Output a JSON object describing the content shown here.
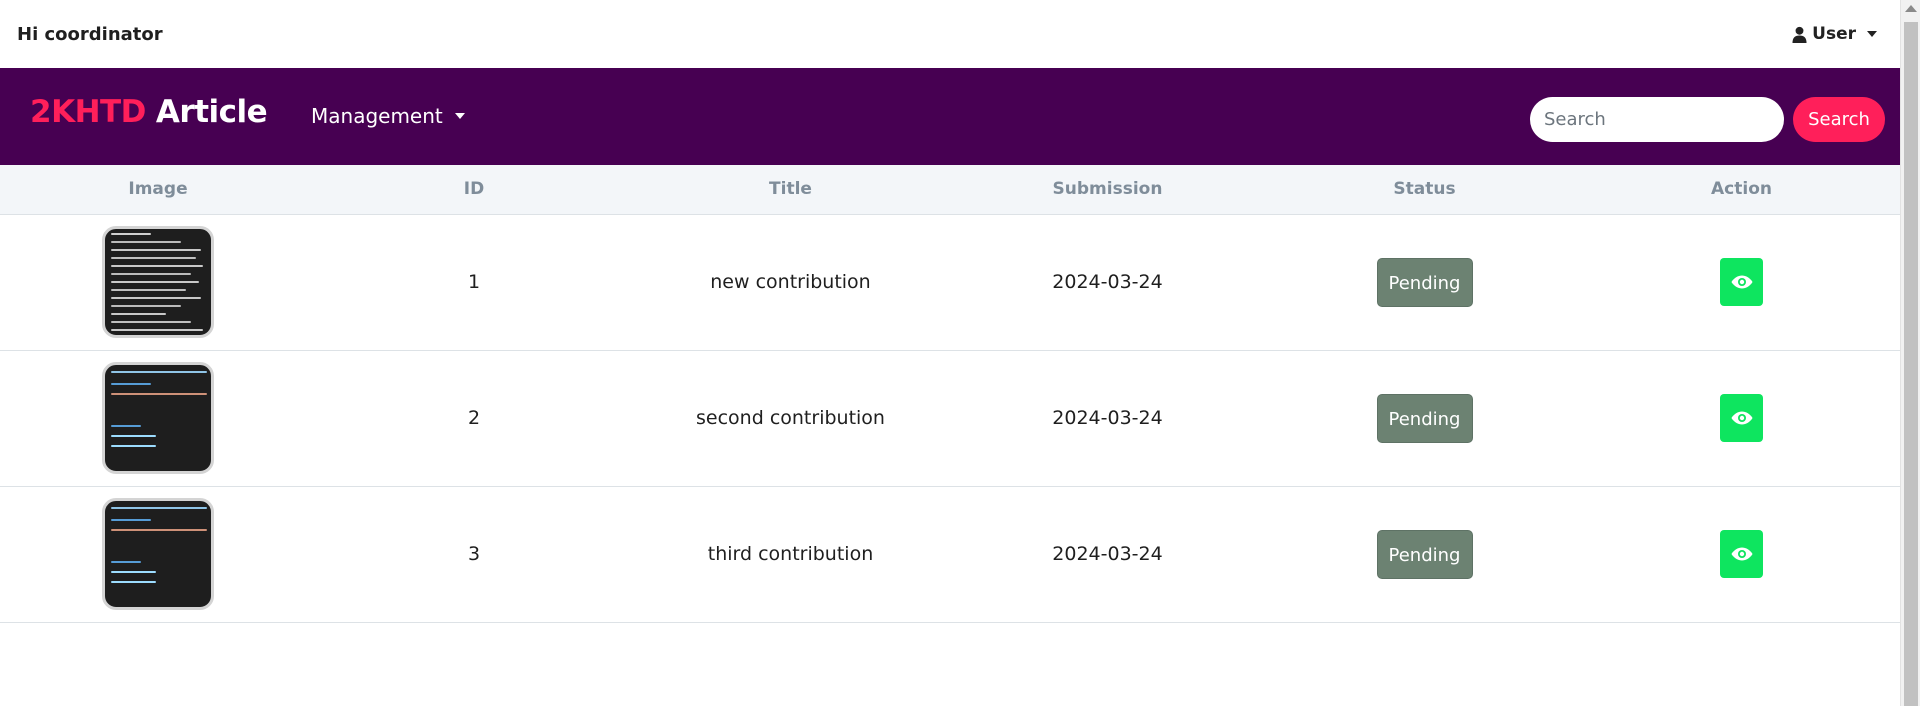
{
  "topbar": {
    "greeting": "Hi coordinator",
    "user_label": "User",
    "user_icon": "person-icon"
  },
  "navbar": {
    "brand_accent": "2KHTD",
    "brand_main": "Article",
    "menu_label": "Management",
    "search_placeholder": "Search",
    "search_button": "Search",
    "colors": {
      "navbar_bg": "#470052",
      "accent": "#ff1f5a",
      "view_button": "#0ee55f",
      "status_pending": "#6c8272"
    }
  },
  "table": {
    "columns": [
      "Image",
      "ID",
      "Title",
      "Submission",
      "Status",
      "Action"
    ],
    "rows": [
      {
        "id": "1",
        "title": "new contribution",
        "submission": "2024-03-24",
        "status": "Pending",
        "thumb": "file-list-screenshot"
      },
      {
        "id": "2",
        "title": "second contribution",
        "submission": "2024-03-24",
        "status": "Pending",
        "thumb": "code-screenshot"
      },
      {
        "id": "3",
        "title": "third contribution",
        "submission": "2024-03-24",
        "status": "Pending",
        "thumb": "code-screenshot"
      }
    ],
    "action_icon": "eye-icon"
  }
}
